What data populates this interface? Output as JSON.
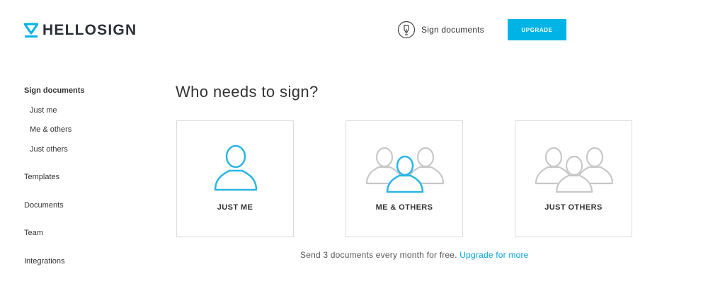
{
  "brand": {
    "name": "HELLOSIGN",
    "accent": "#00b3e6"
  },
  "header": {
    "sign_label": "Sign documents",
    "upgrade_label": "UPGRADE"
  },
  "sidebar": {
    "items": [
      {
        "label": "Sign documents"
      },
      {
        "label": "Just me"
      },
      {
        "label": "Me & others"
      },
      {
        "label": "Just others"
      },
      {
        "label": "Templates"
      },
      {
        "label": "Documents"
      },
      {
        "label": "Team"
      },
      {
        "label": "Integrations"
      }
    ]
  },
  "main": {
    "title": "Who needs to sign?",
    "cards": [
      {
        "label": "JUST ME",
        "icon": "single-user-icon"
      },
      {
        "label": "ME & OTHERS",
        "icon": "group-highlight-user-icon"
      },
      {
        "label": "JUST OTHERS",
        "icon": "group-users-icon"
      }
    ],
    "note": "Send 3 documents every month for free.",
    "note_link": "Upgrade for more"
  }
}
